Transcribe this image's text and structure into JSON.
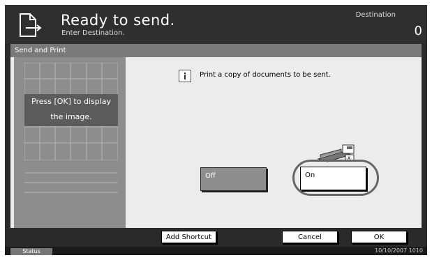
{
  "header": {
    "title": "Ready to send.",
    "subtitle": "Enter Destination.",
    "destination_label": "Destination",
    "destination_count": "0",
    "icon": "send-document-icon"
  },
  "section": {
    "title": "Send and Print"
  },
  "preview": {
    "message_line1": "Press [OK] to display",
    "message_line2": "the image."
  },
  "main": {
    "info_icon": "info-icon",
    "info_text": "Print a copy of documents to be sent.",
    "options": [
      {
        "label": "Off",
        "selected": false
      },
      {
        "label": "On",
        "selected": true
      }
    ],
    "machine_icon": "copier-icon"
  },
  "footer": {
    "add_shortcut_label": "Add Shortcut",
    "cancel_label": "Cancel",
    "ok_label": "OK"
  },
  "status": {
    "label": "Status",
    "datetime": "10/10/2007  1010"
  },
  "colors": {
    "dark_bg": "#2a2a2a",
    "panel_bg": "#ececec",
    "preview_bg": "#8d8d8d",
    "accent_ring": "#666666"
  }
}
